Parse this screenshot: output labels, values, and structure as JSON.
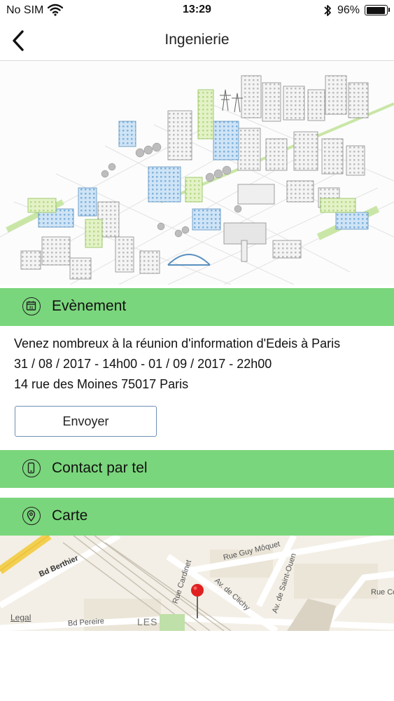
{
  "status_bar": {
    "carrier": "No SIM",
    "time": "13:29",
    "battery_text": "96%",
    "battery_level": 0.96
  },
  "nav": {
    "title": "Ingenierie"
  },
  "sections": {
    "event": {
      "label": "Evènement",
      "icon": "calendar-icon"
    },
    "contact": {
      "label": "Contact par tel",
      "icon": "phone-icon"
    },
    "map": {
      "label": "Carte",
      "icon": "location-pin-icon"
    }
  },
  "event": {
    "description": "Venez nombreux à la réunion d'information d'Edeis à Paris",
    "dates": "31 / 08 / 2017 - 14h00 - 01 / 09 / 2017 - 22h00",
    "address": "14 rue des Moines 75017 Paris",
    "calendar_day": "31",
    "send_label": "Envoyer"
  },
  "map": {
    "streets": {
      "berthier": "Bd Berthier",
      "pereire": "Bd Pereire",
      "cardinet": "Rue Cardinet",
      "clichy": "Av. de Clichy",
      "guy_moquet": "Rue Guy Môquet",
      "saint_ouen": "Av. de Saint-Ouen",
      "cole": "Rue Col",
      "les": "LES"
    },
    "legal": "Legal"
  },
  "colors": {
    "section_green": "#7ad67c",
    "button_border": "#7090b8",
    "pin_red": "#e02020"
  }
}
